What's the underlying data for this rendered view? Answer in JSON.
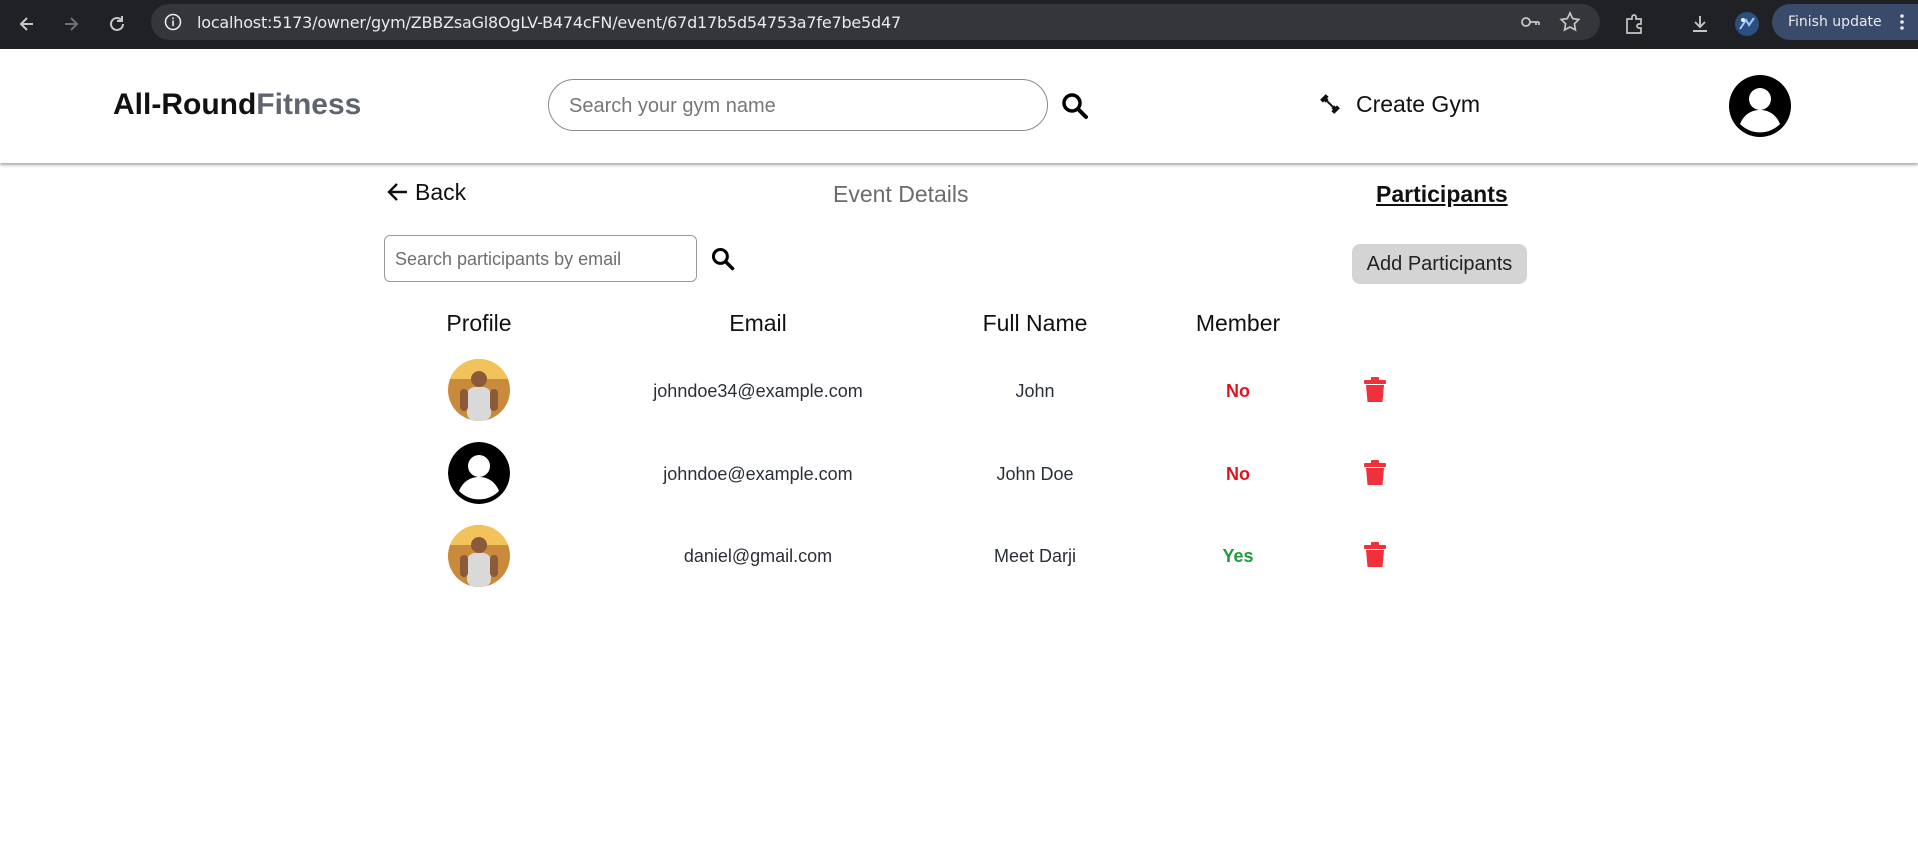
{
  "browser": {
    "url": "localhost:5173/owner/gym/ZBBZsaGl8OgLV-B474cFN/event/67d17b5d54753a7fe7be5d47",
    "finish_update_label": "Finish update"
  },
  "header": {
    "logo_part1": "All-Round",
    "logo_part2": "Fitness",
    "search_placeholder": "Search your gym name",
    "create_gym_label": "Create Gym"
  },
  "subnav": {
    "back_label": "Back",
    "event_details_label": "Event Details",
    "participants_label": "Participants"
  },
  "participants": {
    "search_placeholder": "Search participants by email",
    "add_button_label": "Add Participants",
    "columns": [
      "Profile",
      "Email",
      "Full Name",
      "Member"
    ],
    "rows": [
      {
        "avatar": "photo",
        "email": "johndoe34@example.com",
        "full_name": "John",
        "member": "No"
      },
      {
        "avatar": "default-user-icon",
        "email": "johndoe@example.com",
        "full_name": "John Doe",
        "member": "No"
      },
      {
        "avatar": "photo",
        "email": "daniel@gmail.com",
        "full_name": "Meet Darji",
        "member": "Yes"
      }
    ]
  },
  "colors": {
    "member_no": "#e0141e",
    "member_yes": "#1f9d3c",
    "delete": "#f0313b",
    "chrome_bg": "#202124"
  }
}
